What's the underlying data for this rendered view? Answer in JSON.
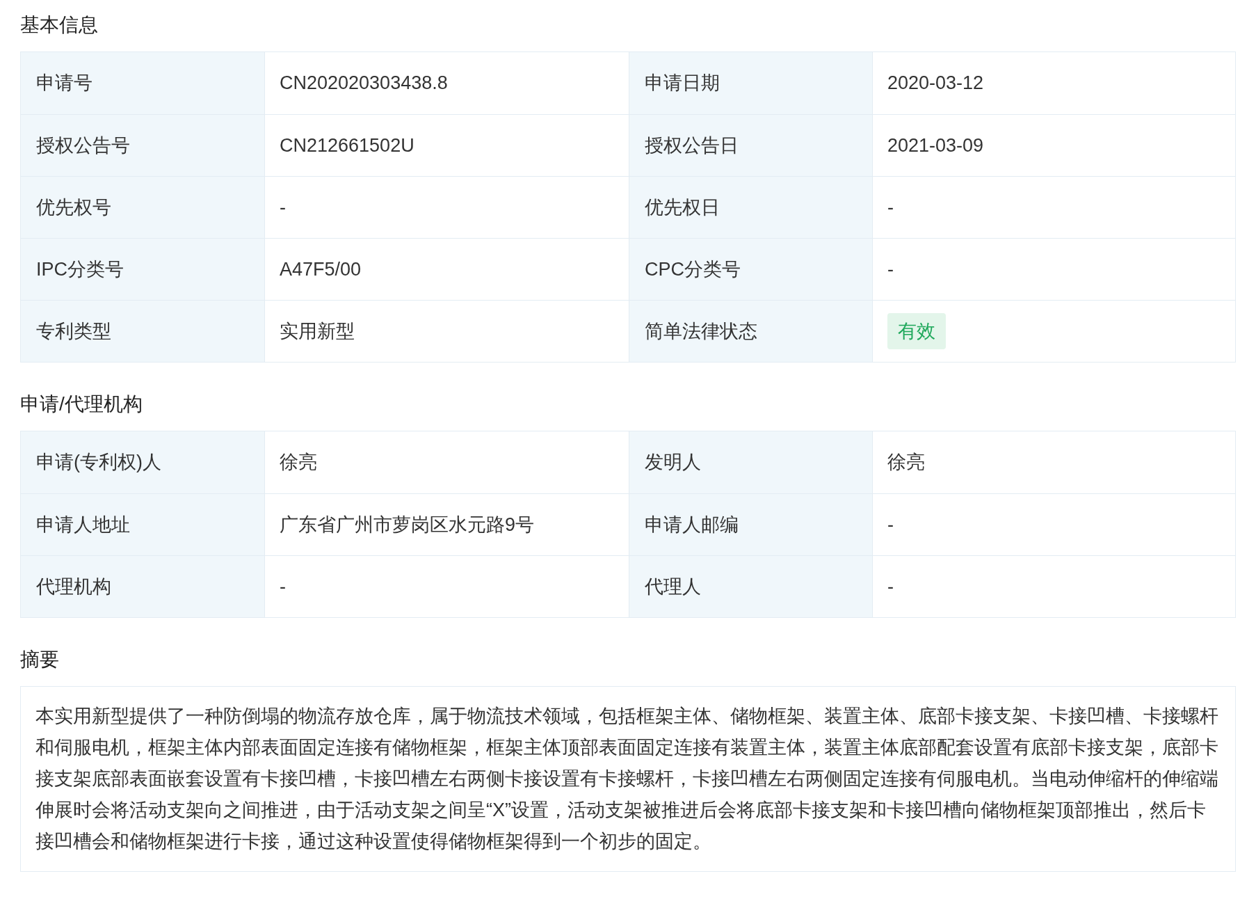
{
  "sections": [
    {
      "title": "基本信息",
      "kind": "table",
      "rows": [
        [
          {
            "label": "申请号",
            "value": "CN202020303438.8",
            "kind": "text"
          },
          {
            "label": "申请日期",
            "value": "2020-03-12",
            "kind": "text"
          }
        ],
        [
          {
            "label": "授权公告号",
            "value": "CN212661502U",
            "kind": "text"
          },
          {
            "label": "授权公告日",
            "value": "2021-03-09",
            "kind": "text"
          }
        ],
        [
          {
            "label": "优先权号",
            "value": "-",
            "kind": "text"
          },
          {
            "label": "优先权日",
            "value": "-",
            "kind": "text"
          }
        ],
        [
          {
            "label": "IPC分类号",
            "value": "A47F5/00",
            "kind": "text"
          },
          {
            "label": "CPC分类号",
            "value": "-",
            "kind": "text"
          }
        ],
        [
          {
            "label": "专利类型",
            "value": "实用新型",
            "kind": "text"
          },
          {
            "label": "简单法律状态",
            "value": "有效",
            "kind": "badge"
          }
        ]
      ]
    },
    {
      "title": "申请/代理机构",
      "kind": "table",
      "rows": [
        [
          {
            "label": "申请(专利权)人",
            "value": "徐亮",
            "kind": "text"
          },
          {
            "label": "发明人",
            "value": "徐亮",
            "kind": "text"
          }
        ],
        [
          {
            "label": "申请人地址",
            "value": "广东省广州市萝岗区水元路9号",
            "kind": "text"
          },
          {
            "label": "申请人邮编",
            "value": "-",
            "kind": "text"
          }
        ],
        [
          {
            "label": "代理机构",
            "value": "-",
            "kind": "text"
          },
          {
            "label": "代理人",
            "value": "-",
            "kind": "text"
          }
        ]
      ]
    },
    {
      "title": "摘要",
      "kind": "text",
      "text": "本实用新型提供了一种防倒塌的物流存放仓库，属于物流技术领域，包括框架主体、储物框架、装置主体、底部卡接支架、卡接凹槽、卡接螺杆和伺服电机，框架主体内部表面固定连接有储物框架，框架主体顶部表面固定连接有装置主体，装置主体底部配套设置有底部卡接支架，底部卡接支架底部表面嵌套设置有卡接凹槽，卡接凹槽左右两侧卡接设置有卡接螺杆，卡接凹槽左右两侧固定连接有伺服电机。当电动伸缩杆的伸缩端伸展时会将活动支架向之间推进，由于活动支架之间呈“X”设置，活动支架被推进后会将底部卡接支架和卡接凹槽向储物框架顶部推出，然后卡接凹槽会和储物框架进行卡接，通过这种设置使得储物框架得到一个初步的固定。"
    }
  ]
}
